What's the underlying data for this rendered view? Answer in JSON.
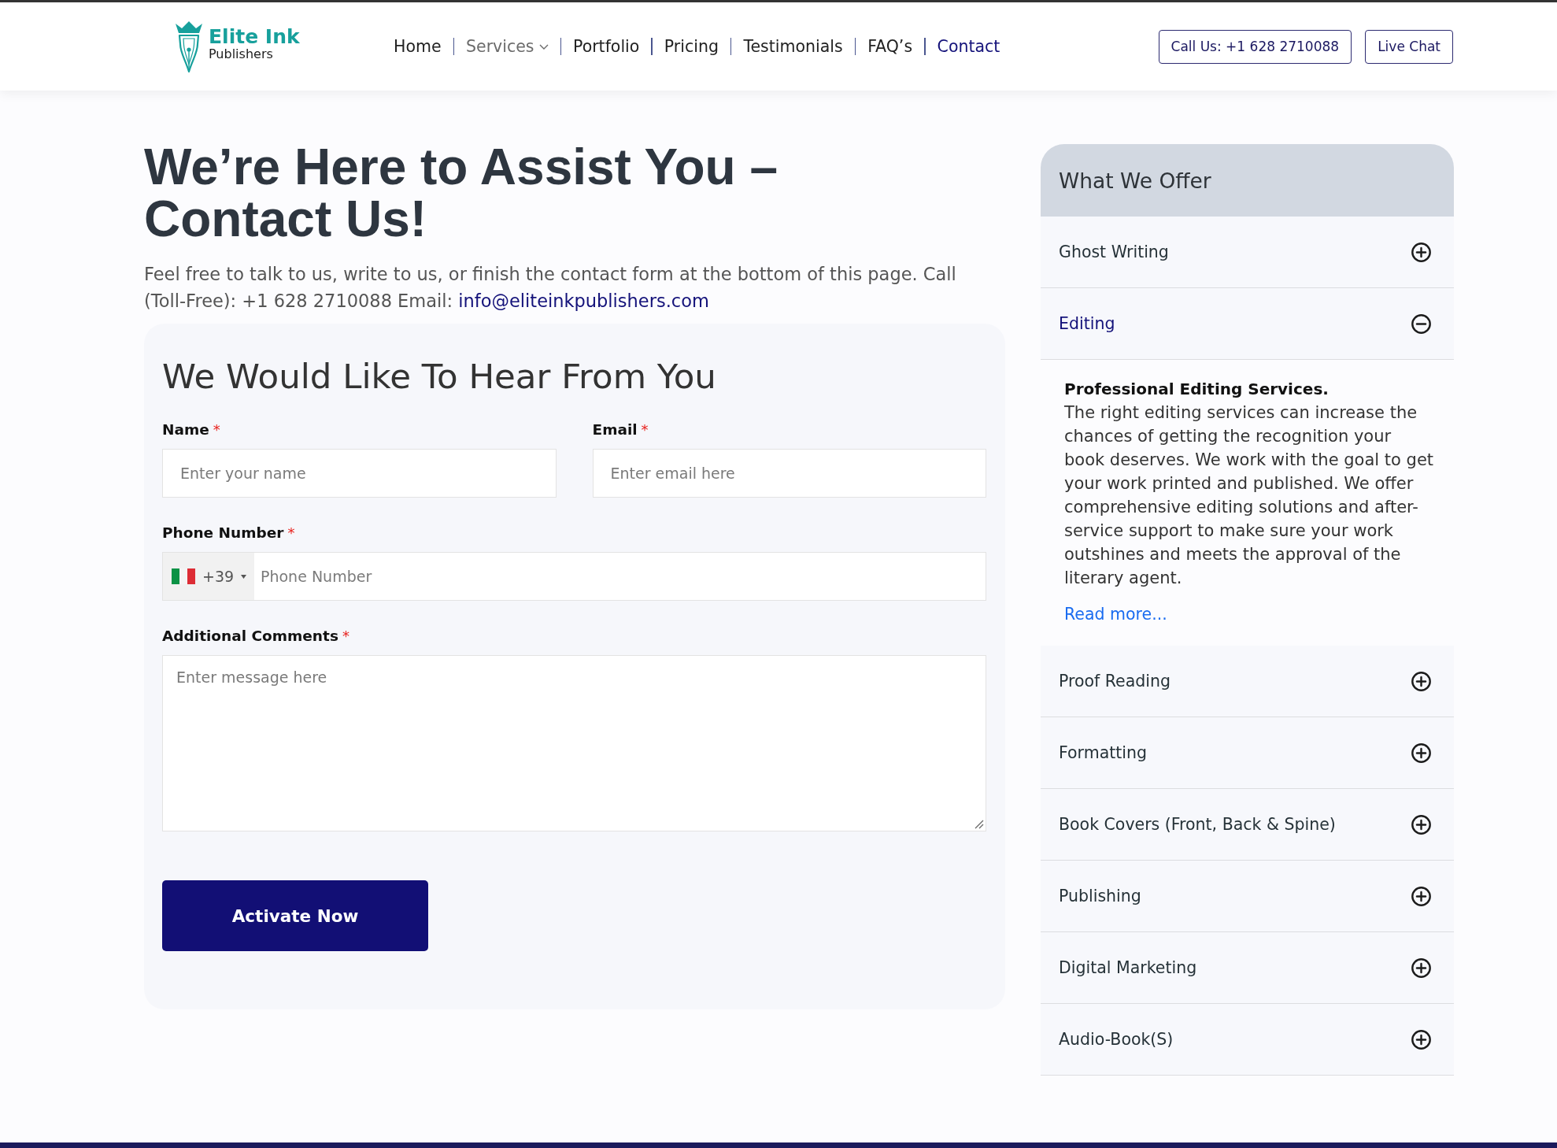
{
  "header": {
    "logo": {
      "name": "Elite Ink",
      "tagline": "Publishers"
    },
    "nav": [
      {
        "label": "Home",
        "kind": "link",
        "selected": false
      },
      {
        "label": "Services",
        "kind": "menu",
        "selected": false
      },
      {
        "label": "Portfolio",
        "kind": "link",
        "selected": false
      },
      {
        "label": "Pricing",
        "kind": "link",
        "selected": false
      },
      {
        "label": "Testimonials",
        "kind": "link",
        "selected": false
      },
      {
        "label": "FAQ’s",
        "kind": "link",
        "selected": false
      },
      {
        "label": "Contact",
        "kind": "link",
        "selected": true
      }
    ],
    "buttons": [
      "Call Us: +1 628 2710088",
      "Live Chat"
    ]
  },
  "intro": {
    "title": "We’re Here to Assist You – Contact Us!",
    "text": "Feel free to talk to us, write to us, or finish the contact form at the bottom of this page. Call (Toll-Free): +1 628 2710088 Email:",
    "email": "info@eliteinkpublishers.com"
  },
  "form": {
    "title": "We Would Like To Hear From You",
    "fields": [
      {
        "kind": "text",
        "label": "Name",
        "mark": "*",
        "placeholder": "Enter your name"
      },
      {
        "kind": "text",
        "label": "Email",
        "mark": "*",
        "placeholder": "Enter email here"
      },
      {
        "kind": "phone",
        "label": "Phone Number",
        "mark": "*",
        "country_code": "+39",
        "placeholder": "Phone Number"
      },
      {
        "kind": "textarea",
        "label": "Additional Comments",
        "mark": "*",
        "placeholder": "Enter message here"
      }
    ],
    "submit": "Activate Now"
  },
  "offer": {
    "title": "What We Offer",
    "items": [
      {
        "label": "Ghost Writing",
        "expanded": false
      },
      {
        "label": "Editing",
        "expanded": true,
        "content": {
          "heading": "Professional Editing Services.",
          "text": "The right editing services can increase the chances of getting the recognition your book deserves. We work with the goal to get your work printed and published. We offer comprehensive editing solutions and after-service support to make sure your work outshines and meets the approval of the literary agent.",
          "link": "Read more..."
        }
      },
      {
        "label": "Proof Reading",
        "expanded": false
      },
      {
        "label": "Formatting",
        "expanded": false
      },
      {
        "label": "Book Covers (Front, Back & Spine)",
        "expanded": false
      },
      {
        "label": "Publishing",
        "expanded": false
      },
      {
        "label": "Digital Marketing",
        "expanded": false
      },
      {
        "label": "Audio-Book(S)",
        "expanded": false
      }
    ]
  }
}
